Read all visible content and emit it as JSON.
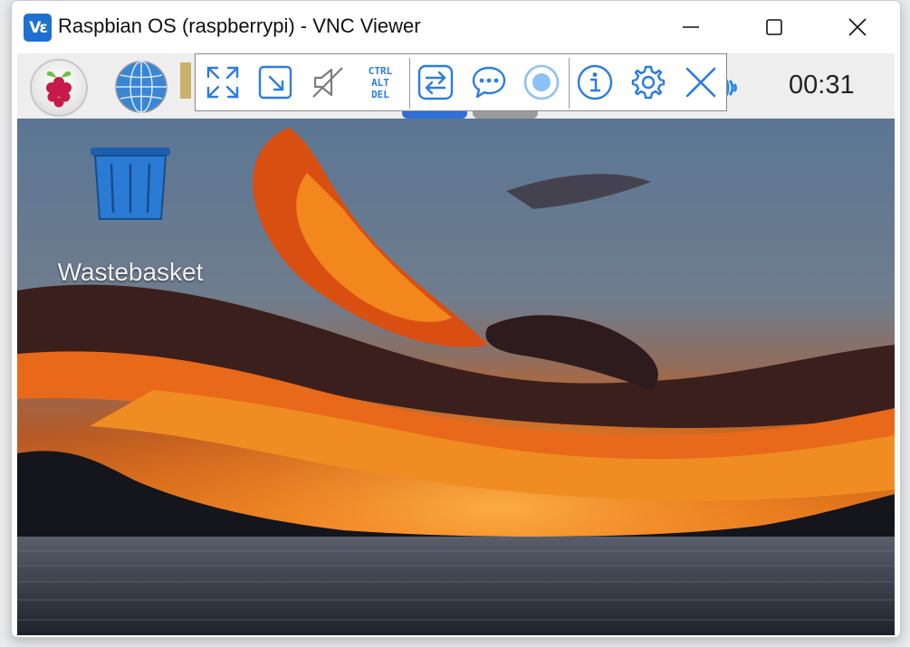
{
  "window": {
    "title": "Raspbian OS (raspberrypi) - VNC Viewer",
    "app_icon_text": "Vε"
  },
  "taskbar": {
    "clock": "00:31"
  },
  "desktop": {
    "icons": [
      {
        "label": "Wastebasket",
        "icon": "wastebasket-icon"
      }
    ]
  },
  "vnc_toolbar": {
    "buttons": [
      {
        "name": "fullscreen",
        "icon": "expand-arrows-icon"
      },
      {
        "name": "scale",
        "icon": "scale-to-window-icon"
      },
      {
        "name": "audio",
        "icon": "audio-muted-icon"
      },
      {
        "name": "ctrl-alt-del",
        "icon": "ctrl-alt-del-icon",
        "lines": [
          "CTRL",
          "ALT",
          "DEL"
        ]
      },
      {
        "name": "file-transfer",
        "icon": "file-transfer-icon"
      },
      {
        "name": "chat",
        "icon": "chat-icon"
      },
      {
        "name": "record",
        "icon": "record-icon"
      },
      {
        "name": "info",
        "icon": "info-icon"
      },
      {
        "name": "settings",
        "icon": "gear-icon"
      },
      {
        "name": "close",
        "icon": "close-icon"
      }
    ]
  },
  "colors": {
    "accent": "#2a7de1",
    "vnc_brand": "#1f6fd1",
    "taskbar_bg": "#eeeeee"
  }
}
